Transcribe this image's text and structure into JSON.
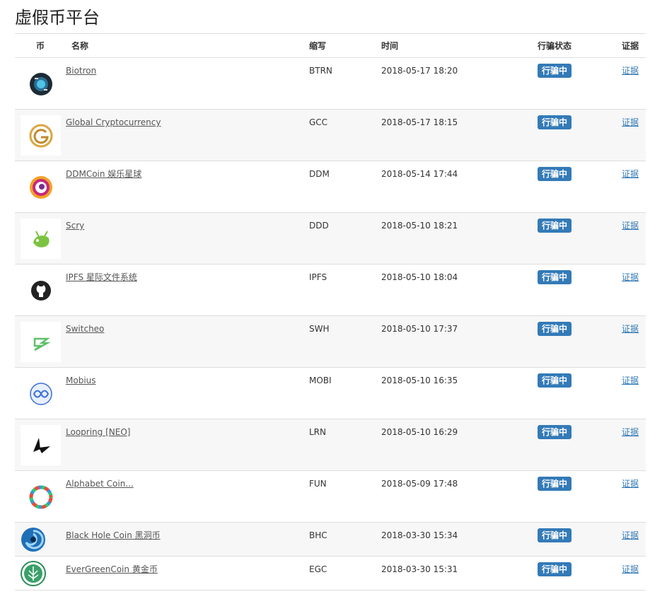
{
  "page": {
    "title": "虚假币平台"
  },
  "columns": {
    "coin": "币",
    "name": "名称",
    "symbol": "缩写",
    "time": "时间",
    "status": "行骗状态",
    "proof": "证据"
  },
  "rows": [
    {
      "name": "Biotron",
      "symbol": "BTRN",
      "time": "2018-05-17 18:20",
      "status": "行骗中",
      "proof": "证据",
      "icon": "biotron-logo-icon"
    },
    {
      "name": "Global Cryptocurrency",
      "symbol": "GCC",
      "time": "2018-05-17 18:15",
      "status": "行骗中",
      "proof": "证据",
      "icon": "gcc-logo-icon"
    },
    {
      "name": "DDMCoin 娱乐星球",
      "symbol": "DDM",
      "time": "2018-05-14 17:44",
      "status": "行骗中",
      "proof": "证据",
      "icon": "ddm-logo-icon"
    },
    {
      "name": "Scry",
      "symbol": "DDD",
      "time": "2018-05-10 18:21",
      "status": "行骗中",
      "proof": "证据",
      "icon": "scry-logo-icon"
    },
    {
      "name": "IPFS 星际文件系统",
      "symbol": "IPFS",
      "time": "2018-05-10 18:04",
      "status": "行骗中",
      "proof": "证据",
      "icon": "github-logo-icon"
    },
    {
      "name": "Switcheo",
      "symbol": "SWH",
      "time": "2018-05-10 17:37",
      "status": "行骗中",
      "proof": "证据",
      "icon": "switcheo-logo-icon"
    },
    {
      "name": "Mobius",
      "symbol": "MOBI",
      "time": "2018-05-10 16:35",
      "status": "行骗中",
      "proof": "证据",
      "icon": "mobius-logo-icon"
    },
    {
      "name": "Loopring [NEO]",
      "symbol": "LRN",
      "time": "2018-05-10 16:29",
      "status": "行骗中",
      "proof": "证据",
      "icon": "loopring-logo-icon"
    },
    {
      "name": "Alphabet Coin...",
      "symbol": "FUN",
      "time": "2018-05-09 17:48",
      "status": "行骗中",
      "proof": "证据",
      "icon": "alphabet-logo-icon"
    },
    {
      "name": "Black Hole Coin 黑洞币",
      "symbol": "BHC",
      "time": "2018-03-30 15:34",
      "status": "行骗中",
      "proof": "证据",
      "icon": "blackhole-logo-icon"
    },
    {
      "name": "EverGreenCoin 黄金币",
      "symbol": "EGC",
      "time": "2018-03-30 15:31",
      "status": "行骗中",
      "proof": "证据",
      "icon": "evergreen-logo-icon"
    }
  ],
  "colors": {
    "badge": "#337ab7",
    "link": "#337ab7",
    "stripe": "#f7f7f7",
    "border": "#dddddd"
  }
}
